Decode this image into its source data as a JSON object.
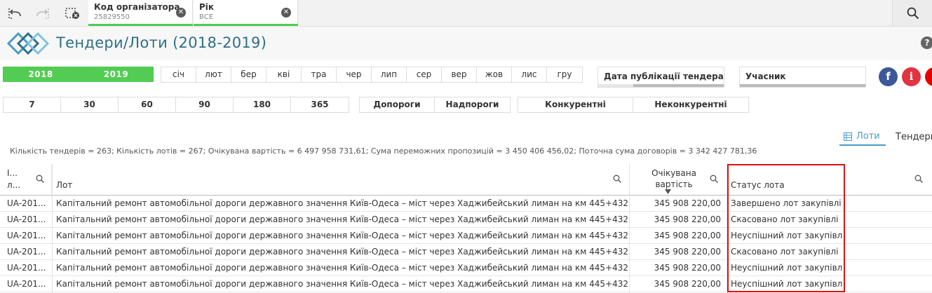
{
  "toolbar": {
    "back_icon": "selections-back-icon",
    "forward_icon": "selections-forward-icon",
    "clear_icon": "clear-selections-icon",
    "search_icon": "search-icon"
  },
  "selections": [
    {
      "name": "Код організатора",
      "value": "25829550"
    },
    {
      "name": "Рік",
      "value": "ВСЕ"
    }
  ],
  "header": {
    "title": "Тендери/Лоти (2018-2019)",
    "help": "?"
  },
  "years": [
    "2018",
    "2019"
  ],
  "months": [
    "січ",
    "лют",
    "бер",
    "кві",
    "тра",
    "чер",
    "лип",
    "сер",
    "вер",
    "жов",
    "лис",
    "гру"
  ],
  "listboxes": {
    "date": "Дата публікації тендера",
    "participant": "Учасник"
  },
  "social": {
    "facebook": "f",
    "info": "i"
  },
  "days": [
    "7",
    "30",
    "60",
    "90",
    "180",
    "365"
  ],
  "thresholds": [
    "Допороги",
    "Надпороги"
  ],
  "competition": [
    "Конкурентні",
    "Неконкурентні"
  ],
  "tabs": {
    "lots": "Лоти",
    "tenders": "Тендери"
  },
  "summary": "Кількість тендерів = 263; Кількість лотів = 267; Очікувана вартість = 6 497 958 731,61; Сума переможних пропозицій = 3 450 406 456,02; Поточна сума договорів = 3 342 427 781,36",
  "table": {
    "columns": {
      "id_line1": "І...",
      "id_line2": "л...",
      "lot": "Лот",
      "value_line1": "Очікувана",
      "value_line2": "вартість",
      "status": "Статус лота"
    },
    "rows": [
      {
        "id": "UA-201...",
        "lot": "Капітальний ремонт автомобільної дороги державного значення Київ-Одеса – міст через Хаджибейський лиман на км 445+432",
        "value": "345 908 220,00",
        "status": "Завершено лот закупівлі"
      },
      {
        "id": "UA-201...",
        "lot": "Капітальний ремонт автомобільної дороги державного значення Київ-Одеса – міст через Хаджибейський лиман на км 445+432",
        "value": "345 908 220,00",
        "status": "Скасовано лот закупівлі"
      },
      {
        "id": "UA-201...",
        "lot": "Капітальний ремонт автомобільної дороги державного значення Київ-Одеса – міст через Хаджибейський лиман на км 445+432",
        "value": "345 908 220,00",
        "status": "Неуспішний лот закупівлі"
      },
      {
        "id": "UA-201...",
        "lot": "Капітальний ремонт автомобільної дороги державного значення Київ-Одеса – міст через Хаджибейський лиман на км 445+432",
        "value": "345 908 220,00",
        "status": "Скасовано лот закупівлі"
      },
      {
        "id": "UA-201...",
        "lot": "Капітальний ремонт автомобільної дороги державного значення Київ-Одеса – міст через Хаджибейський лиман на км 445+432",
        "value": "345 908 220,00",
        "status": "Неуспішний лот закупівлі"
      },
      {
        "id": "UA-201...",
        "lot": "Капітальний ремонт автомобільної дороги державного значення Київ-Одеса – міст через Хаджибейський лиман на км 445+432",
        "value": "345 908 220,00",
        "status": "Неуспішний лот закупівлі"
      }
    ]
  },
  "colors": {
    "accent_green": "#52cc52",
    "title_blue": "#2f6f86",
    "highlight_red": "#dd1111",
    "facebook": "#3b5998"
  }
}
